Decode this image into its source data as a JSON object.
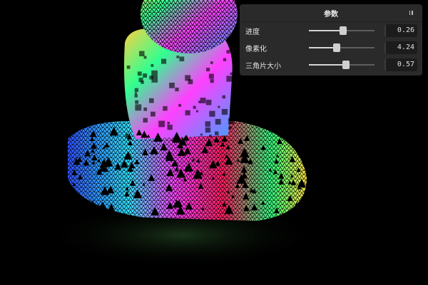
{
  "panel": {
    "title": "参数",
    "collapse_icon": "pause-icon"
  },
  "params": [
    {
      "label": "进度",
      "value": "0.26",
      "fraction": 0.52
    },
    {
      "label": "像素化",
      "value": "4.24",
      "fraction": 0.42
    },
    {
      "label": "三角片大小",
      "value": "0.57",
      "fraction": 0.57
    }
  ],
  "colors": {
    "background": "#000000",
    "panel_bg": "#2a2a2a",
    "input_bg": "#1c1c1c",
    "slider_knob": "#cfcfcf"
  }
}
